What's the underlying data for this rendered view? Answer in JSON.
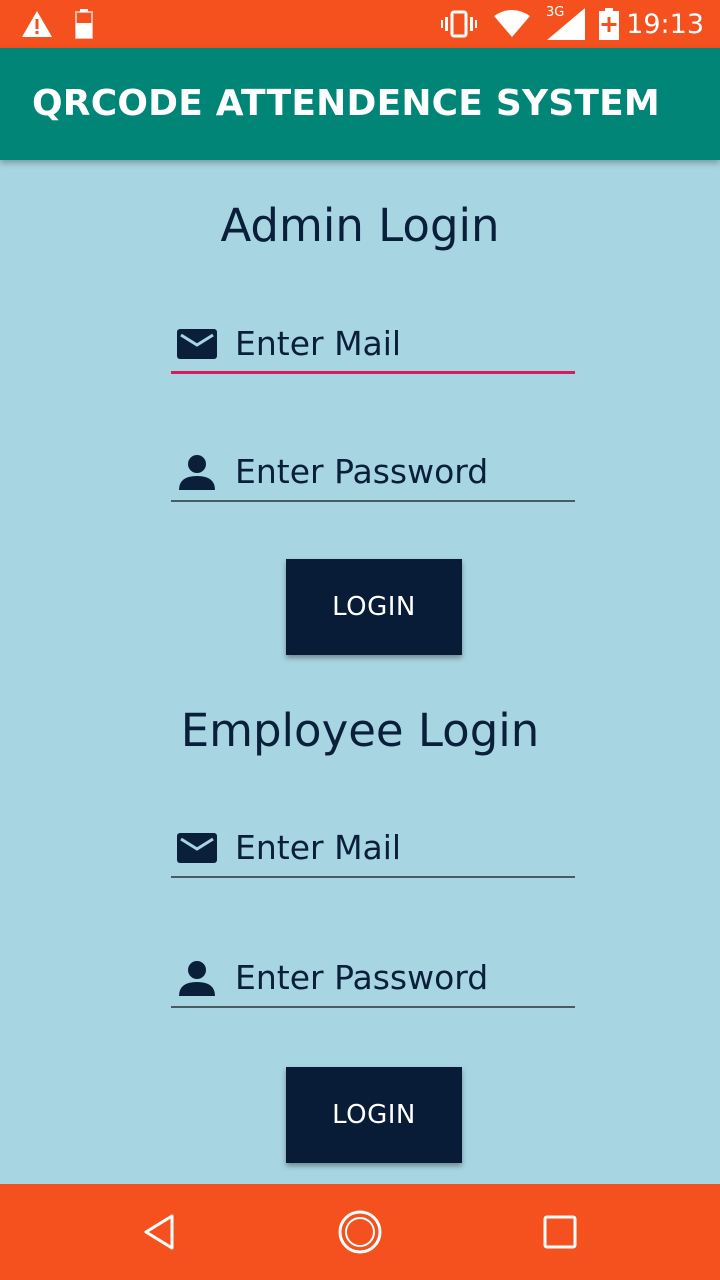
{
  "status_bar": {
    "time": "19:13",
    "network": "3G",
    "icons": [
      "warning-icon",
      "battery-low-icon",
      "vibrate-icon",
      "wifi-icon",
      "signal-icon",
      "battery-charging-icon"
    ]
  },
  "app_bar": {
    "title": "QRCODE ATTENDENCE SYSTEM"
  },
  "admin": {
    "heading": "Admin Login",
    "mail_placeholder": "Enter Mail",
    "password_placeholder": "Enter Password",
    "login_label": "LOGIN"
  },
  "employee": {
    "heading": "Employee Login",
    "mail_placeholder": "Enter Mail",
    "password_placeholder": "Enter Password",
    "login_label": "LOGIN"
  },
  "nav_bar": {
    "icons": [
      "back-icon",
      "home-icon",
      "recents-icon"
    ]
  },
  "colors": {
    "status_bar": "#f4511e",
    "app_bar": "#008577",
    "background": "#a8d5e2",
    "button": "#081c37",
    "focus_underline": "#d81b60"
  }
}
